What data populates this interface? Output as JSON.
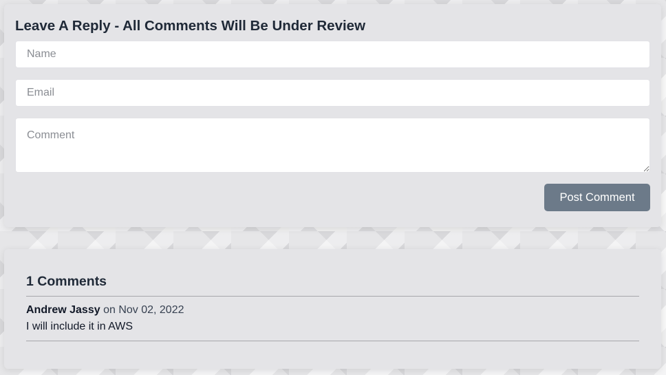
{
  "reply_form": {
    "title": "Leave A Reply - All Comments Will Be Under Review",
    "name_placeholder": "Name",
    "email_placeholder": "Email",
    "comment_placeholder": "Comment",
    "submit_label": "Post Comment"
  },
  "comments_section": {
    "heading": "1 Comments",
    "comments": [
      {
        "author": "Andrew Jassy",
        "on_word": "on",
        "date": "Nov 02, 2022",
        "text": "I will include it in AWS"
      }
    ]
  },
  "colors": {
    "button": "#6c7a89",
    "card": "#e4e4e7",
    "field": "#ffffff"
  }
}
